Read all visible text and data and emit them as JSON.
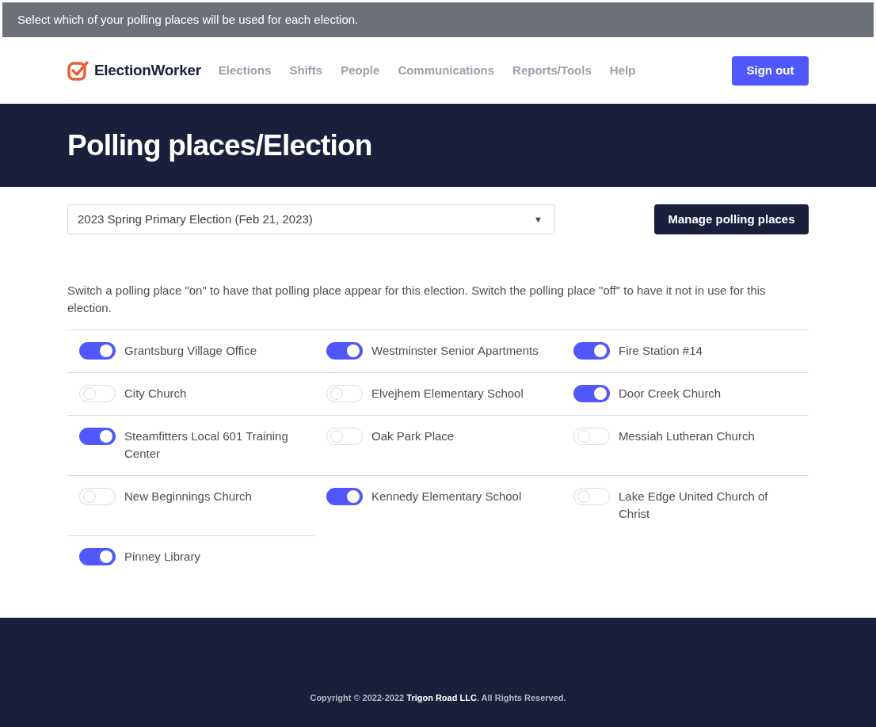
{
  "banner": "Select which of your polling places will be used for each election.",
  "header": {
    "logo": "ElectionWorker",
    "nav": [
      "Elections",
      "Shifts",
      "People",
      "Communications",
      "Reports/Tools",
      "Help"
    ],
    "sign_out": "Sign out"
  },
  "hero": {
    "title": "Polling places/Election"
  },
  "election_select": {
    "value": "2023 Spring Primary Election (Feb 21, 2023)",
    "caret": "▼"
  },
  "manage_button": "Manage polling places",
  "instructions": "Switch a polling place \"on\" to have that polling place appear for this election. Switch the polling place \"off\" to have it not in use for this election.",
  "polling_places": [
    {
      "name": "Grantsburg Village Office",
      "on": true
    },
    {
      "name": "Westminster Senior Apartments",
      "on": true
    },
    {
      "name": "Fire Station #14",
      "on": true
    },
    {
      "name": "City Church",
      "on": false
    },
    {
      "name": "Elvejhem Elementary School",
      "on": false
    },
    {
      "name": "Door Creek Church",
      "on": true
    },
    {
      "name": "Steamfitters Local 601 Training Center",
      "on": true
    },
    {
      "name": "Oak Park Place",
      "on": false
    },
    {
      "name": "Messiah Lutheran Church",
      "on": false
    },
    {
      "name": "New Beginnings Church",
      "on": false
    },
    {
      "name": "Kennedy Elementary School",
      "on": true
    },
    {
      "name": "Lake Edge United Church of Christ",
      "on": false
    },
    {
      "name": "Pinney Library",
      "on": true
    }
  ],
  "footer": {
    "copyright": "Copyright © 2022-2022 **Trigon Road LLC**. All Rights Reserved."
  }
}
